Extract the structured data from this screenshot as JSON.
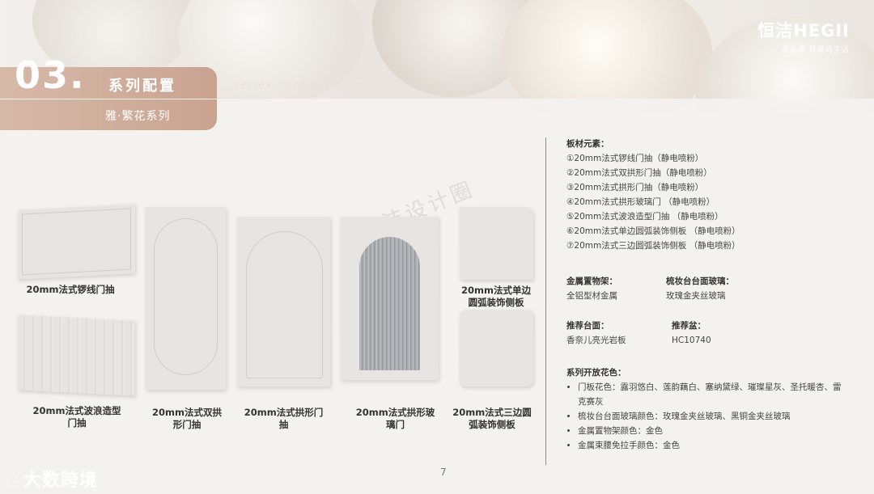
{
  "brand": {
    "logo": "恒洁HEGII",
    "slogan": "选品质  就是选生活"
  },
  "section": {
    "number": "03.",
    "title": "系列配置",
    "title_en": "Series Configuration",
    "subtitle": "雅·繁花系列"
  },
  "watermark": "恒洁设计圈",
  "panels": {
    "p1": "20mm法式锣线门抽",
    "p2": "20mm法式波浪造型门抽",
    "p3": "20mm法式双拱形门抽",
    "p4": "20mm法式拱形门抽",
    "p5": "20mm法式拱形玻璃门",
    "p6": "20mm法式单边圆弧装饰侧板",
    "p7": "20mm法式三边圆弧装饰侧板"
  },
  "specs": {
    "materials_title": "板材元素：",
    "materials": [
      "①20mm法式锣线门抽（静电喷粉）",
      "②20mm法式双拱形门抽（静电喷粉）",
      "③20mm法式拱形门抽（静电喷粉）",
      "④20mm法式拱形玻璃门 （静电喷粉）",
      "⑤20mm法式波浪造型门抽 （静电喷粉）",
      "⑥20mm法式单边圆弧装饰侧板 （静电喷粉）",
      "⑦20mm法式三边圆弧装饰侧板 （静电喷粉）"
    ],
    "metal_shelf_title": "金属置物架：",
    "metal_shelf_value": "全铝型材金属",
    "vanity_glass_title": "梳妆台台面玻璃：",
    "vanity_glass_value": "玫瑰金夹丝玻璃",
    "countertop_title": "推荐台面：",
    "countertop_value": "香奈儿亮光岩板",
    "basin_title": "推荐盆：",
    "basin_value": "HC10740",
    "colors_title": "系列开放花色：",
    "colors": [
      "门板花色：露羽悠白、莲韵藕白、塞纳黛绿、璀璨星灰、圣托暖杏、雷克赛灰",
      "梳妆台台面玻璃颜色：玫瑰金夹丝玻璃、黑铜金夹丝玻璃",
      "金属置物架颜色：金色",
      "金属束腰免拉手颜色：金色"
    ]
  },
  "page_number": "7",
  "footer": {
    "logo": "大数跨境"
  }
}
